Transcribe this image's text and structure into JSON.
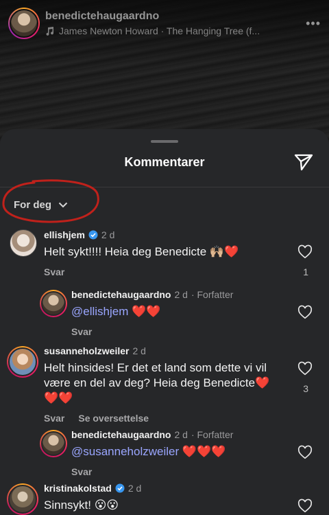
{
  "post": {
    "username": "benedictehaugaardno",
    "music": "James Newton Howard · The Hanging Tree (f...",
    "more": "•••"
  },
  "sheet": {
    "title": "Kommentarer",
    "sort_label": "For deg"
  },
  "comments": [
    {
      "user": "ellishjem",
      "verified": true,
      "time": "2 d",
      "text": "Helt sykt!!!! Heia deg Benedicte 🙌🏼❤️",
      "reply": "Svar",
      "likes": "1"
    },
    {
      "user": "benedictehaugaardno",
      "time": "2 d",
      "tag": "· Forfatter",
      "mention": "@ellishjem",
      "text": "❤️❤️",
      "reply": "Svar"
    },
    {
      "user": "susanneholzweiler",
      "time": "2 d",
      "text": "Helt hinsides! Er det et land som dette vi vil være en del av deg? Heia deg Benedicte❤️❤️❤️",
      "reply": "Svar",
      "translate": "Se oversettelse",
      "likes": "3"
    },
    {
      "user": "benedictehaugaardno",
      "time": "2 d",
      "tag": "· Forfatter",
      "mention": "@susanneholzweiler",
      "text": "❤️❤️❤️",
      "reply": "Svar"
    },
    {
      "user": "kristinakolstad",
      "verified": true,
      "time": "2 d",
      "text": "Sinnsykt! 😮😮"
    }
  ],
  "colors": {
    "annotation": "#c0211b",
    "mention": "#9aa6ff",
    "verified": "#3897f0"
  }
}
